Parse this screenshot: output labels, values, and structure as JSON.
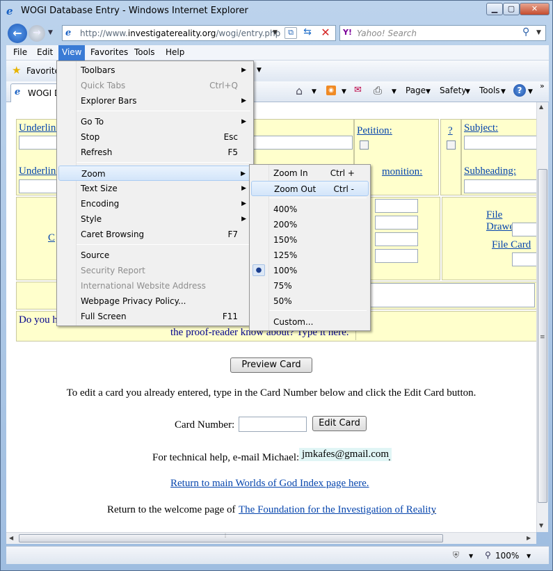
{
  "window": {
    "title": "WOGI Database Entry - Windows Internet Explorer"
  },
  "nav": {
    "url_prefix": "http://www.",
    "url_domain": "investigatereality.org",
    "url_path": "/wogi/entry.php",
    "search_placeholder": "Yahoo! Search",
    "search_brand": "Y!"
  },
  "menubar": {
    "items": [
      "File",
      "Edit",
      "View",
      "Favorites",
      "Tools",
      "Help"
    ]
  },
  "favbar": {
    "label": "Favorite"
  },
  "tab": {
    "label": "WOGI D"
  },
  "commandbar": {
    "page": "Page",
    "safety": "Safety",
    "tools": "Tools"
  },
  "view_menu": [
    {
      "label": "Toolbars",
      "shortcut": "",
      "submenu": true,
      "disabled": false
    },
    {
      "label": "Quick Tabs",
      "shortcut": "Ctrl+Q",
      "submenu": false,
      "disabled": true
    },
    {
      "label": "Explorer Bars",
      "shortcut": "",
      "submenu": true,
      "disabled": false
    },
    {
      "label": "Go To",
      "shortcut": "",
      "submenu": true,
      "disabled": false
    },
    {
      "label": "Stop",
      "shortcut": "Esc",
      "submenu": false,
      "disabled": false
    },
    {
      "label": "Refresh",
      "shortcut": "F5",
      "submenu": false,
      "disabled": false
    },
    {
      "label": "Zoom",
      "shortcut": "",
      "submenu": true,
      "disabled": false
    },
    {
      "label": "Text Size",
      "shortcut": "",
      "submenu": true,
      "disabled": false
    },
    {
      "label": "Encoding",
      "shortcut": "",
      "submenu": true,
      "disabled": false
    },
    {
      "label": "Style",
      "shortcut": "",
      "submenu": true,
      "disabled": false
    },
    {
      "label": "Caret Browsing",
      "shortcut": "F7",
      "submenu": false,
      "disabled": false
    },
    {
      "label": "Source",
      "shortcut": "",
      "submenu": false,
      "disabled": false
    },
    {
      "label": "Security Report",
      "shortcut": "",
      "submenu": false,
      "disabled": true
    },
    {
      "label": "International Website Address",
      "shortcut": "",
      "submenu": false,
      "disabled": true
    },
    {
      "label": "Webpage Privacy Policy...",
      "shortcut": "",
      "submenu": false,
      "disabled": false
    },
    {
      "label": "Full Screen",
      "shortcut": "F11",
      "submenu": false,
      "disabled": false
    }
  ],
  "zoom_menu": [
    {
      "label": "Zoom In",
      "shortcut": "Ctrl +"
    },
    {
      "label": "Zoom Out",
      "shortcut": "Ctrl -"
    },
    {
      "label": "400%",
      "shortcut": ""
    },
    {
      "label": "200%",
      "shortcut": ""
    },
    {
      "label": "150%",
      "shortcut": ""
    },
    {
      "label": "125%",
      "shortcut": ""
    },
    {
      "label": "100%",
      "shortcut": "",
      "selected": true
    },
    {
      "label": "75%",
      "shortcut": ""
    },
    {
      "label": "50%",
      "shortcut": ""
    },
    {
      "label": "Custom...",
      "shortcut": ""
    }
  ],
  "form": {
    "underline1": "Underline",
    "underline2": "Underline",
    "petition": "Petition:",
    "question": "?",
    "subject": "Subject:",
    "admonition": "monition:",
    "subheading": "Subheading:",
    "c_link": "C",
    "file_drawer": "File Drawer",
    "file_card": "File Card",
    "do_you_h": "Do you h",
    "proofreader": "the proof-reader know about? Type it here."
  },
  "page": {
    "preview_button": "Preview Card",
    "edit_instructions": "To edit a card you already entered, type in the Card Number below and click the Edit Card button.",
    "card_number_label": "Card Number:",
    "edit_button": "Edit Card",
    "tech_help": "For technical help, e-mail Michael:",
    "email": "jmkafes@gmail.com",
    "return_index": "Return to main Worlds of God Index page here.",
    "return_welcome_prefix": "Return to the welcome page of",
    "foundation_link": "The Foundation for the Investigation of Reality",
    "period": "."
  },
  "status": {
    "zoom": "100%"
  }
}
